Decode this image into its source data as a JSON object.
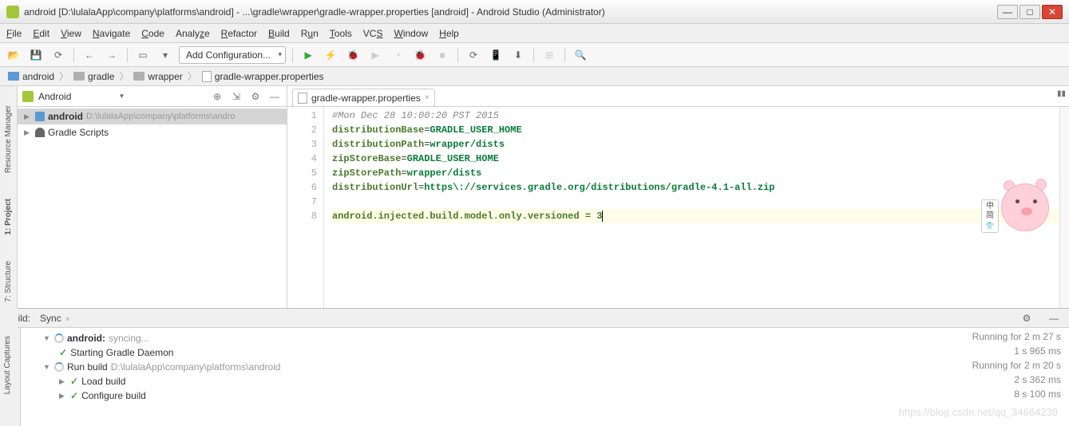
{
  "titlebar": {
    "text": "android [D:\\lulalaApp\\company\\platforms\\android] - ...\\gradle\\wrapper\\gradle-wrapper.properties [android] - Android Studio (Administrator)"
  },
  "menu": [
    "File",
    "Edit",
    "View",
    "Navigate",
    "Code",
    "Analyze",
    "Refactor",
    "Build",
    "Run",
    "Tools",
    "VCS",
    "Window",
    "Help"
  ],
  "toolbar": {
    "config_label": "Add Configuration..."
  },
  "breadcrumb": [
    "android",
    "gradle",
    "wrapper",
    "gradle-wrapper.properties"
  ],
  "project_panel": {
    "title": "Android",
    "rows": [
      {
        "arrow": "▶",
        "label": "android",
        "path": "D:\\lulalaApp\\company\\platforms\\andro",
        "bold": true,
        "icon": "module",
        "selected": true
      },
      {
        "arrow": "▶",
        "label": "Gradle Scripts",
        "path": "",
        "bold": false,
        "icon": "gradle",
        "selected": false
      }
    ]
  },
  "editor": {
    "tab_label": "gradle-wrapper.properties",
    "lines": [
      {
        "n": 1,
        "type": "comment",
        "text": "#Mon Dec 28 10:00:20 PST 2015"
      },
      {
        "n": 2,
        "type": "kv",
        "key": "distributionBase",
        "val": "GRADLE_USER_HOME"
      },
      {
        "n": 3,
        "type": "kv",
        "key": "distributionPath",
        "val": "wrapper/dists"
      },
      {
        "n": 4,
        "type": "kv",
        "key": "zipStoreBase",
        "val": "GRADLE_USER_HOME"
      },
      {
        "n": 5,
        "type": "kv",
        "key": "zipStorePath",
        "val": "wrapper/dists"
      },
      {
        "n": 6,
        "type": "kv",
        "key": "distributionUrl",
        "val": "https\\://services.gradle.org/distributions/gradle-4.1-all.zip"
      },
      {
        "n": 7,
        "type": "blank"
      },
      {
        "n": 8,
        "type": "hl",
        "text": "android.injected.build.model.only.versioned = 3"
      }
    ]
  },
  "build": {
    "tab1": "Build:",
    "tab2": "Sync",
    "rows": [
      {
        "indent": 0,
        "arrow": "▼",
        "spin": true,
        "label": "android:",
        "extra": "syncing...",
        "bold": true,
        "time": "Running for 2 m 27 s"
      },
      {
        "indent": 1,
        "check": true,
        "label": "Starting Gradle Daemon",
        "time": "1 s 965 ms"
      },
      {
        "indent": 0,
        "arrow": "▼",
        "spin": true,
        "label": "Run build",
        "path": "D:\\lulalaApp\\company\\platforms\\android",
        "time": "Running for 2 m 20 s"
      },
      {
        "indent": 1,
        "arrow": "▶",
        "check": true,
        "label": "Load build",
        "time": "2 s 362 ms"
      },
      {
        "indent": 1,
        "arrow": "▶",
        "check": true,
        "label": "Configure build",
        "time": "8 s 100 ms"
      }
    ]
  },
  "mascot": {
    "tag_lines": [
      "中",
      "简"
    ]
  },
  "watermark": "https://blog.csdn.net/qq_34664239",
  "left_gutters": [
    "Resource Manager",
    "1: Project",
    "7: Structure"
  ],
  "left_bottom": "Layout Captures"
}
